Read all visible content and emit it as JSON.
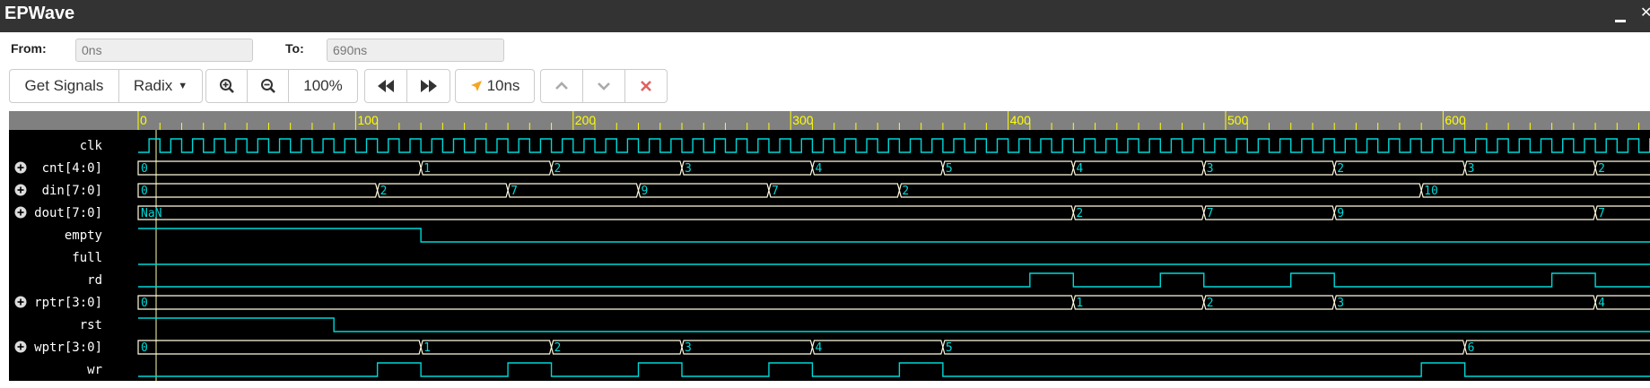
{
  "app": {
    "title": "EPWave"
  },
  "range": {
    "from_label": "From:",
    "from_value": "0ns",
    "to_label": "To:",
    "to_value": "690ns"
  },
  "toolbar": {
    "get_signals": "Get Signals",
    "radix": "Radix",
    "zoom_level": "100%",
    "step": "10ns"
  },
  "colors": {
    "header": "#333333",
    "ruler": "#808080",
    "ruler_text": "#ffff00",
    "wave": "#00d8d8",
    "bus": "#fffbe0",
    "background": "#000000"
  },
  "icons": [
    "zoom-in-icon",
    "zoom-out-icon",
    "rewind-icon",
    "fast-forward-icon",
    "cursor-arrow-icon",
    "chevron-up-icon",
    "chevron-down-icon",
    "close-icon",
    "minimize-icon",
    "expand-icon"
  ],
  "timeline": {
    "unit": "ns",
    "start": 0,
    "end": 690,
    "ticks": [
      0,
      100,
      200,
      300,
      400,
      500,
      600
    ],
    "clock_period": 10
  },
  "signals": [
    {
      "name": "clk",
      "type": "clock",
      "period": 10,
      "initial": 0
    },
    {
      "name": "cnt[4:0]",
      "type": "bus",
      "expandable": true,
      "changes": [
        [
          0,
          "0"
        ],
        [
          130,
          "1"
        ],
        [
          190,
          "2"
        ],
        [
          250,
          "3"
        ],
        [
          310,
          "4"
        ],
        [
          370,
          "5"
        ],
        [
          430,
          "4"
        ],
        [
          490,
          "3"
        ],
        [
          550,
          "2"
        ],
        [
          610,
          "3"
        ],
        [
          670,
          "2"
        ]
      ]
    },
    {
      "name": "din[7:0]",
      "type": "bus",
      "expandable": true,
      "changes": [
        [
          0,
          "0"
        ],
        [
          110,
          "2"
        ],
        [
          170,
          "7"
        ],
        [
          230,
          "9"
        ],
        [
          290,
          "7"
        ],
        [
          350,
          "2"
        ],
        [
          590,
          "10"
        ]
      ]
    },
    {
      "name": "dout[7:0]",
      "type": "bus",
      "expandable": true,
      "changes": [
        [
          0,
          "NaN"
        ],
        [
          430,
          "2"
        ],
        [
          490,
          "7"
        ],
        [
          550,
          "9"
        ],
        [
          670,
          "7"
        ]
      ]
    },
    {
      "name": "empty",
      "type": "bit",
      "changes": [
        [
          0,
          1
        ],
        [
          130,
          0
        ]
      ]
    },
    {
      "name": "full",
      "type": "bit",
      "changes": [
        [
          0,
          0
        ]
      ]
    },
    {
      "name": "rd",
      "type": "bit",
      "changes": [
        [
          0,
          0
        ],
        [
          410,
          1
        ],
        [
          430,
          0
        ],
        [
          470,
          1
        ],
        [
          490,
          0
        ],
        [
          530,
          1
        ],
        [
          550,
          0
        ],
        [
          650,
          1
        ],
        [
          670,
          0
        ]
      ]
    },
    {
      "name": "rptr[3:0]",
      "type": "bus",
      "expandable": true,
      "changes": [
        [
          0,
          "0"
        ],
        [
          430,
          "1"
        ],
        [
          490,
          "2"
        ],
        [
          550,
          "3"
        ],
        [
          670,
          "4"
        ]
      ]
    },
    {
      "name": "rst",
      "type": "bit",
      "changes": [
        [
          0,
          1
        ],
        [
          90,
          0
        ]
      ]
    },
    {
      "name": "wptr[3:0]",
      "type": "bus",
      "expandable": true,
      "changes": [
        [
          0,
          "0"
        ],
        [
          130,
          "1"
        ],
        [
          190,
          "2"
        ],
        [
          250,
          "3"
        ],
        [
          310,
          "4"
        ],
        [
          370,
          "5"
        ],
        [
          610,
          "6"
        ]
      ]
    },
    {
      "name": "wr",
      "type": "bit",
      "changes": [
        [
          0,
          0
        ],
        [
          110,
          1
        ],
        [
          130,
          0
        ],
        [
          170,
          1
        ],
        [
          190,
          0
        ],
        [
          230,
          1
        ],
        [
          250,
          0
        ],
        [
          290,
          1
        ],
        [
          310,
          0
        ],
        [
          350,
          1
        ],
        [
          370,
          0
        ],
        [
          590,
          1
        ],
        [
          610,
          0
        ]
      ]
    }
  ]
}
